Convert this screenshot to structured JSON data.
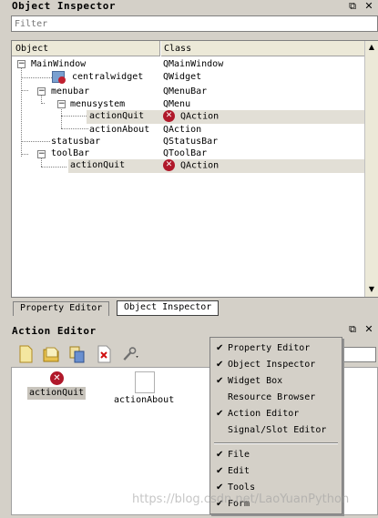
{
  "inspector": {
    "title": "Object Inspector",
    "filter_placeholder": "Filter",
    "columns": [
      "Object",
      "Class"
    ],
    "rows": [
      {
        "object": "MainWindow",
        "class": "QMainWindow"
      },
      {
        "object": "centralwidget",
        "class": "QWidget"
      },
      {
        "object": "menubar",
        "class": "QMenuBar"
      },
      {
        "object": "menusystem",
        "class": "QMenu"
      },
      {
        "object": "actionQuit",
        "class": "QAction"
      },
      {
        "object": "actionAbout",
        "class": "QAction"
      },
      {
        "object": "statusbar",
        "class": "QStatusBar"
      },
      {
        "object": "toolBar",
        "class": "QToolBar"
      },
      {
        "object": "actionQuit",
        "class": "QAction"
      }
    ]
  },
  "tabs": [
    "Property Editor",
    "Object Inspector"
  ],
  "action_editor": {
    "title": "Action Editor",
    "actions": [
      "actionQuit",
      "actionAbout"
    ]
  },
  "context_menu": {
    "items": [
      "Property Editor",
      "Object Inspector",
      "Widget Box",
      "Resource Browser",
      "Action Editor",
      "Signal/Slot Editor",
      "File",
      "Edit",
      "Tools",
      "Form"
    ]
  },
  "watermark": "https://blog.csdn.net/LaoYuanPython",
  "colors": {
    "selected_row": "#e2dfd6",
    "quit_icon": "#b0182a"
  },
  "icons": [
    "float-icon",
    "close-icon",
    "new-action-icon",
    "open-folder-icon",
    "copy-icon",
    "delete-icon",
    "wrench-icon"
  ]
}
